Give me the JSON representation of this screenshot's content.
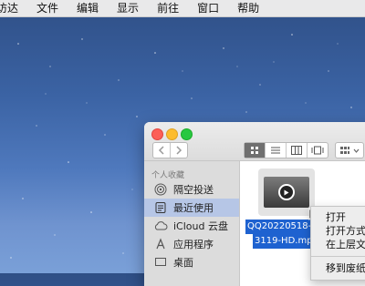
{
  "menubar": {
    "items": [
      "访达",
      "文件",
      "编辑",
      "显示",
      "前往",
      "窗口",
      "帮助"
    ]
  },
  "finder": {
    "sidebar": {
      "section": "个人收藏",
      "items": [
        {
          "label": "隔空投送",
          "icon": "airdrop-icon"
        },
        {
          "label": "最近使用",
          "icon": "recents-icon",
          "selected": true
        },
        {
          "label": "iCloud 云盘",
          "icon": "cloud-icon"
        },
        {
          "label": "应用程序",
          "icon": "applications-icon"
        },
        {
          "label": "桌面",
          "icon": "desktop-icon"
        }
      ]
    },
    "file": {
      "label_line1": "QQ20220518-",
      "label_line2": "3119-HD.mp"
    }
  },
  "context_menu": {
    "items": [
      "打开",
      "打开方式",
      "在上层文",
      "移到废纸"
    ]
  },
  "colors": {
    "selection": "#1e62d0",
    "sidebar_selected": "#b6c6e6",
    "wallpaper": "#3b63a4"
  }
}
